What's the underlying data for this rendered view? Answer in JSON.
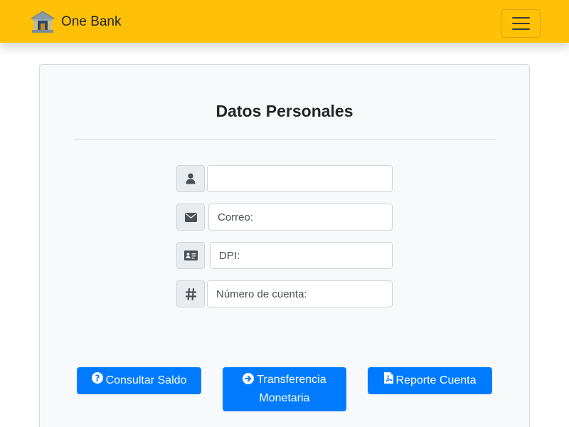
{
  "navbar": {
    "brand_name": "One Bank",
    "logo_icon": "bank-building-icon",
    "menu_icon": "hamburger-menu-icon",
    "background_color": "#ffc107"
  },
  "form": {
    "title": "Datos Personales",
    "fields": [
      {
        "icon": "user-icon",
        "value": "",
        "placeholder": ""
      },
      {
        "icon": "envelope-icon",
        "value": "",
        "placeholder": "Correo:"
      },
      {
        "icon": "id-card-icon",
        "value": "",
        "placeholder": "DPI:"
      },
      {
        "icon": "hash-icon",
        "value": "",
        "placeholder": "Número de cuenta:"
      }
    ]
  },
  "actions": {
    "consultar": {
      "label": "Consultar Saldo",
      "icon": "question-circle-icon"
    },
    "transferencia": {
      "label_line1": "Transferencia",
      "label_line2": "Monetaria",
      "icon": "arrow-circle-right-icon"
    },
    "reporte": {
      "label": "Reporte Cuenta",
      "icon": "pdf-file-icon"
    },
    "button_color": "#007bff"
  }
}
